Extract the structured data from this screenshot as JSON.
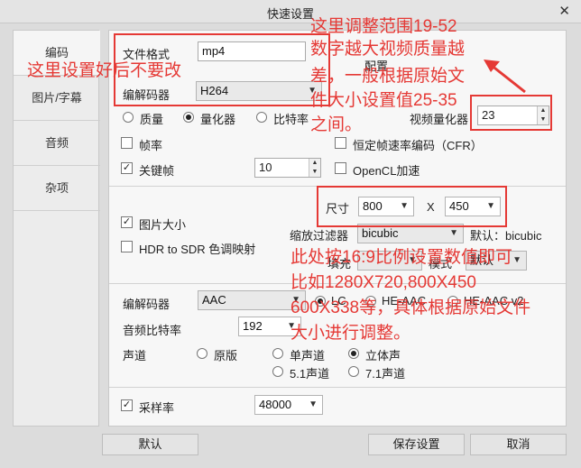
{
  "window": {
    "title": "快速设置",
    "close": "✕"
  },
  "sidebar": {
    "items": [
      {
        "label": "编码"
      },
      {
        "label": "图片/字幕"
      },
      {
        "label": "音频"
      },
      {
        "label": "杂项"
      }
    ]
  },
  "video": {
    "format_label": "文件格式",
    "format_value": "mp4",
    "codec_label": "编解码器",
    "codec_value": "H264",
    "config_label": "配置",
    "rc_modes": [
      "质量",
      "量化器",
      "比特率"
    ],
    "rc_selected": "量化器",
    "quantizer_label": "视频量化器",
    "quantizer_value": "23",
    "framerate_label": "帧率",
    "cfr_label": "恒定帧速率编码（CFR）",
    "keyframe_label": "关键帧",
    "keyframe_value": "10",
    "opencl_label": "OpenCL加速"
  },
  "picture": {
    "size_label": "图片大小",
    "dim_label": "尺寸",
    "width_value": "800",
    "x_label": "X",
    "height_value": "450",
    "hdr_label": "HDR to SDR 色调映射",
    "scale_filter_label": "缩放过滤器",
    "scale_filter_value": "bicubic",
    "default_label": "默认：bicubic",
    "fill_label": "填充",
    "mode_label": "模式",
    "mode_value": "默认"
  },
  "audio": {
    "codec_label": "编解码器",
    "codec_value": "AAC",
    "profiles": [
      "LC",
      "HE-AAC",
      "HE-AAC v2"
    ],
    "profile_selected": "LC",
    "bitrate_label": "音频比特率",
    "bitrate_value": "192",
    "channel_label": "声道",
    "channels": [
      "原版",
      "单声道",
      "立体声",
      "5.1声道",
      "7.1声道"
    ],
    "channel_selected": "立体声",
    "samplerate_label": "采样率",
    "samplerate_value": "48000"
  },
  "footer": {
    "default": "默认",
    "save": "保存设置",
    "cancel": "取消"
  },
  "annotations": {
    "left": "这里设置好后不要改",
    "quant": [
      "这里调整范围19-52",
      "数字越大视频质量越",
      "差，一般根据原始文",
      "件大小设置值25-35",
      "之间。"
    ],
    "size": [
      "此处按16:9比例设置数值即可",
      "比如1280X720,800X450",
      "600X338等，具体根据原始文件",
      "大小进行调整。"
    ]
  },
  "colors": {
    "annotation_red": "#e53935"
  }
}
